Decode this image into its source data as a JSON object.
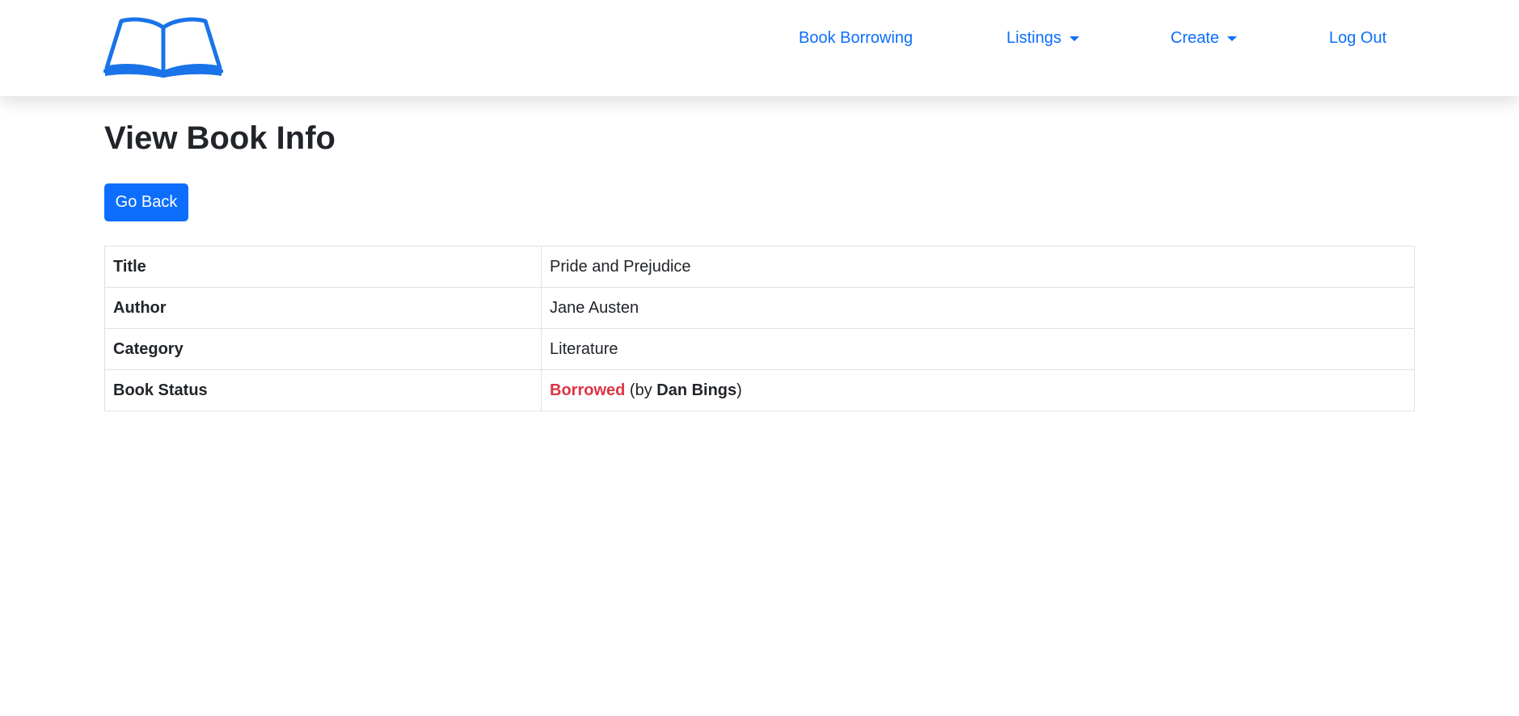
{
  "nav": {
    "logo": "book-logo-icon",
    "links": [
      {
        "label": "Book Borrowing",
        "dropdown": false
      },
      {
        "label": "Listings",
        "dropdown": true
      },
      {
        "label": "Create",
        "dropdown": true
      },
      {
        "label": "Log Out",
        "dropdown": false
      }
    ]
  },
  "page": {
    "title": "View Book Info",
    "back_button": "Go Back"
  },
  "book": {
    "rows": [
      {
        "label": "Title",
        "value": "Pride and Prejudice"
      },
      {
        "label": "Author",
        "value": "Jane Austen"
      },
      {
        "label": "Category",
        "value": "Literature"
      }
    ],
    "status": {
      "label": "Book Status",
      "value": "Borrowed",
      "by_prefix": "(by ",
      "borrower": "Dan Bings",
      "by_suffix": ")"
    }
  },
  "colors": {
    "primary": "#0d6efd",
    "danger": "#dc3545",
    "text": "#212529",
    "border": "#dee2e6"
  }
}
